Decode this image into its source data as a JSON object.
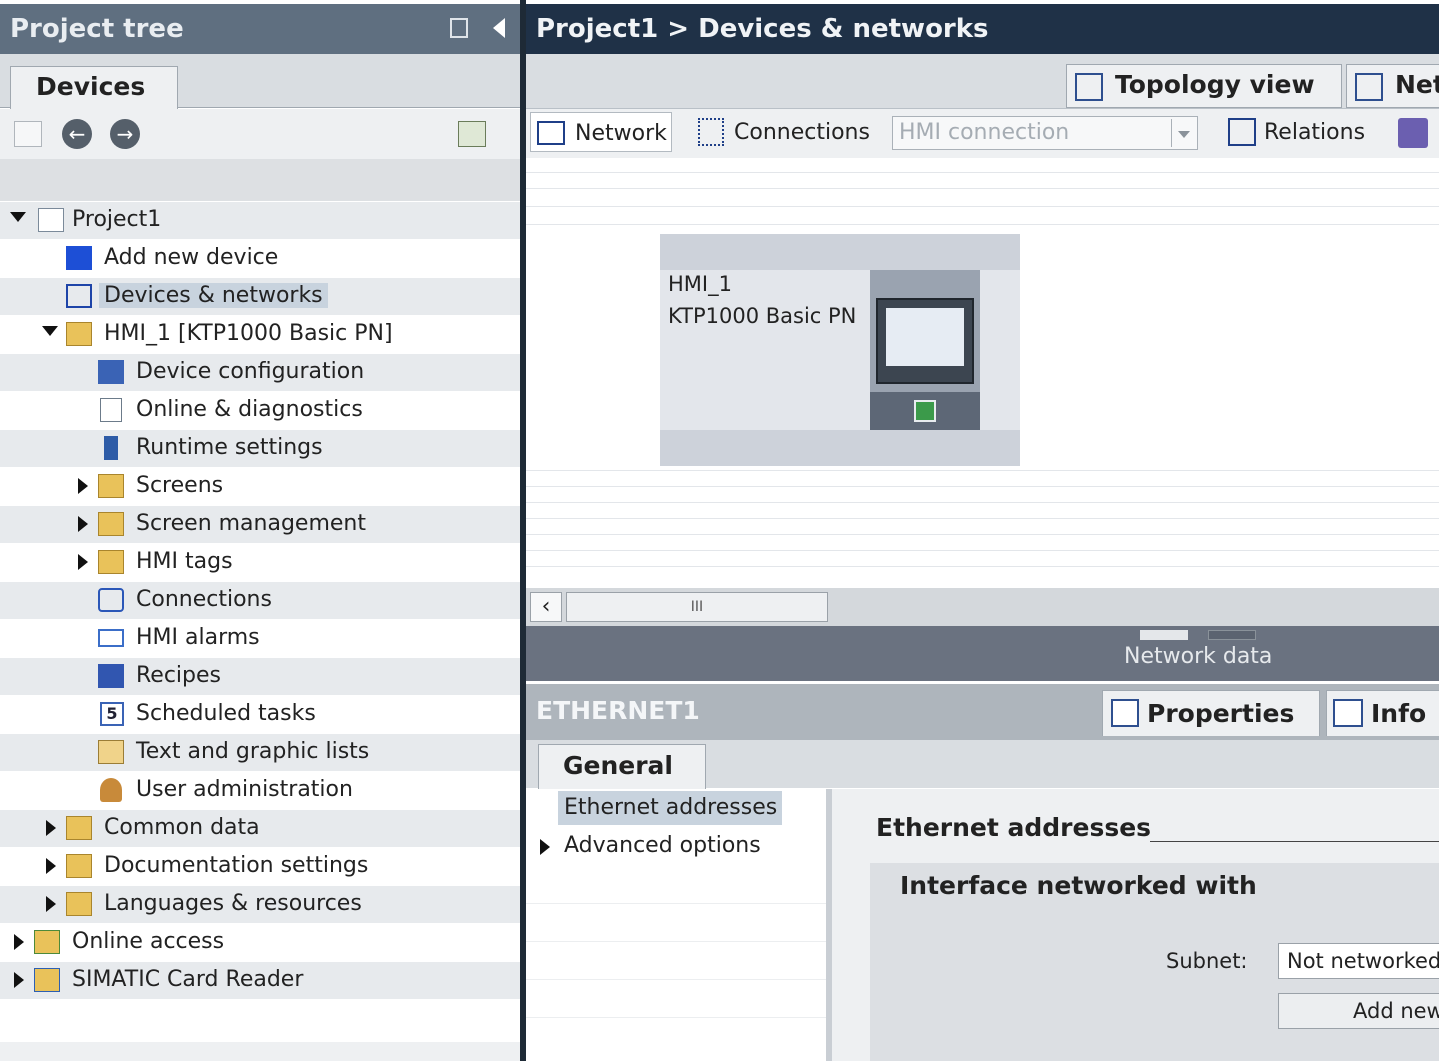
{
  "project_tree": {
    "title": "Project tree",
    "tab_label": "Devices",
    "items": [
      {
        "label": "Project1",
        "expanded": true
      },
      {
        "label": "Add new device"
      },
      {
        "label": "Devices & networks",
        "selected": true
      },
      {
        "label": "HMI_1 [KTP1000 Basic PN]",
        "expanded": true
      },
      {
        "label": "Device configuration"
      },
      {
        "label": "Online & diagnostics"
      },
      {
        "label": "Runtime settings"
      },
      {
        "label": "Screens",
        "expanded": false
      },
      {
        "label": "Screen management",
        "expanded": false
      },
      {
        "label": "HMI tags",
        "expanded": false
      },
      {
        "label": "Connections"
      },
      {
        "label": "HMI alarms"
      },
      {
        "label": "Recipes"
      },
      {
        "label": "Scheduled tasks"
      },
      {
        "label": "Text and graphic lists"
      },
      {
        "label": "User administration"
      },
      {
        "label": "Common data",
        "expanded": false
      },
      {
        "label": "Documentation settings",
        "expanded": false
      },
      {
        "label": "Languages & resources",
        "expanded": false
      },
      {
        "label": "Online access",
        "expanded": false
      },
      {
        "label": "SIMATIC Card Reader",
        "expanded": false
      }
    ]
  },
  "editor": {
    "breadcrumb": "Project1 > Devices & networks",
    "view_tabs": {
      "topology": "Topology view",
      "network": "Net"
    },
    "toolbar": {
      "network": "Network",
      "connections": "Connections",
      "connection_type": "HMI connection",
      "relations": "Relations"
    },
    "device": {
      "name": "HMI_1",
      "type": "KTP1000 Basic PN"
    },
    "network_data_label": "Network data",
    "scrollbar_grip": "III"
  },
  "inspector": {
    "object_name": "ETHERNET1",
    "tabs": {
      "properties": "Properties",
      "info": "Info"
    },
    "general_tab": "General",
    "nav": [
      {
        "label": "Ethernet addresses",
        "selected": true
      },
      {
        "label": "Advanced options",
        "expandable": true
      }
    ],
    "section_title": "Ethernet addresses",
    "group_title": "Interface networked with",
    "subnet_label": "Subnet:",
    "subnet_value": "Not networked",
    "add_button": "Add new subnet"
  }
}
